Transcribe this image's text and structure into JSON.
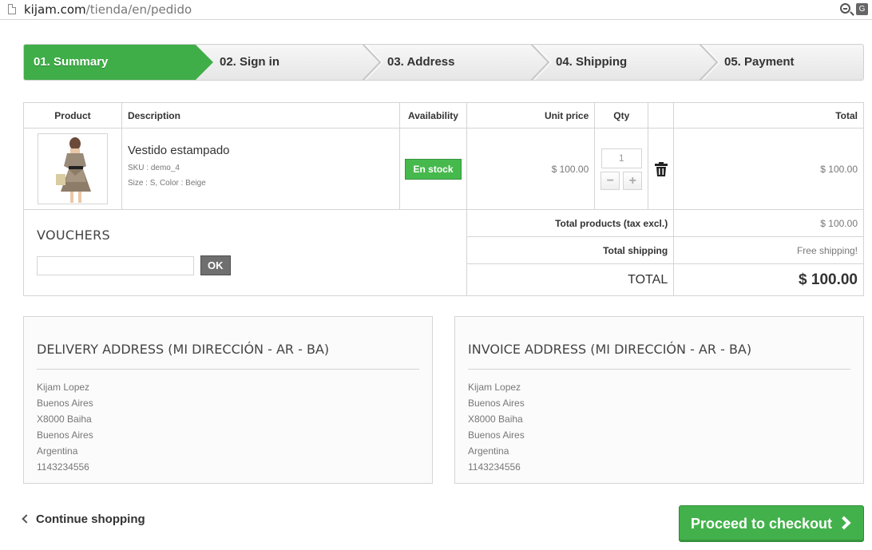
{
  "browser": {
    "url_host": "kijam.com",
    "url_path": "/tienda/en/pedido"
  },
  "steps": [
    {
      "label": "01. Summary",
      "active": true
    },
    {
      "label": "02. Sign in",
      "active": false
    },
    {
      "label": "03. Address",
      "active": false
    },
    {
      "label": "04. Shipping",
      "active": false
    },
    {
      "label": "05. Payment",
      "active": false
    }
  ],
  "cart": {
    "headers": {
      "product": "Product",
      "description": "Description",
      "availability": "Availability",
      "unit_price": "Unit price",
      "qty": "Qty",
      "total": "Total"
    },
    "item": {
      "name": "Vestido estampado",
      "sku": "SKU : demo_4",
      "attributes": "Size : S, Color : Beige",
      "availability": "En stock",
      "unit_price": "$ 100.00",
      "qty": "1",
      "total": "$ 100.00"
    },
    "vouchers_title": "VOUCHERS",
    "voucher_button": "OK",
    "totals": {
      "products_label": "Total products (tax excl.)",
      "products_value": "$ 100.00",
      "shipping_label": "Total shipping",
      "shipping_value": "Free shipping!",
      "total_label": "TOTAL",
      "total_value": "$ 100.00"
    }
  },
  "delivery": {
    "title": "DELIVERY ADDRESS (MI DIRECCIÓN - AR - BA)",
    "lines": [
      "Kijam Lopez",
      "Buenos Aires",
      "X8000 Baiha",
      "Buenos Aires",
      "Argentina",
      "1143234556"
    ]
  },
  "invoice": {
    "title": "INVOICE ADDRESS (MI DIRECCIÓN - AR - BA)",
    "lines": [
      "Kijam Lopez",
      "Buenos Aires",
      "X8000 Baiha",
      "Buenos Aires",
      "Argentina",
      "1143234556"
    ]
  },
  "footer": {
    "continue": "Continue shopping",
    "checkout": "Proceed to checkout"
  },
  "colors": {
    "accent_green": "#3fae48",
    "border": "#d6d4d4"
  }
}
